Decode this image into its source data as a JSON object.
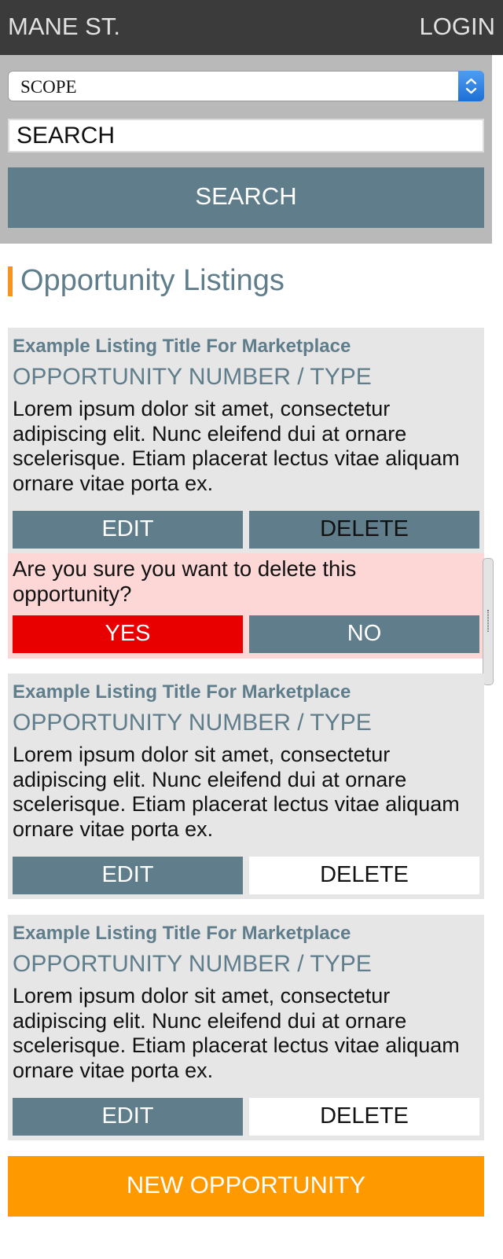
{
  "header": {
    "brand": "MANE ST.",
    "login_label": "LOGIN"
  },
  "search": {
    "scope_label": "SCOPE",
    "input_placeholder": "SEARCH",
    "button_label": "SEARCH"
  },
  "main": {
    "heading": "Opportunity Listings",
    "listings": [
      {
        "title": "Example Listing Title For Marketplace",
        "type": "OPPORTUNITY NUMBER / TYPE",
        "description": "Lorem ipsum dolor sit amet, consectetur adipiscing elit. Nunc eleifend dui at ornare scelerisque. Etiam placerat lectus vitae aliquam ornare vitae porta ex.",
        "edit_label": "EDIT",
        "delete_label": "DELETE"
      },
      {
        "title": "Example Listing Title For Marketplace",
        "type": "OPPORTUNITY NUMBER / TYPE",
        "description": "Lorem ipsum dolor sit amet, consectetur adipiscing elit. Nunc eleifend dui at ornare scelerisque. Etiam placerat lectus vitae aliquam ornare vitae porta ex.",
        "edit_label": "EDIT",
        "delete_label": "DELETE"
      },
      {
        "title": "Example Listing Title For Marketplace",
        "type": "OPPORTUNITY NUMBER / TYPE",
        "description": "Lorem ipsum dolor sit amet, consectetur adipiscing elit. Nunc eleifend dui at ornare scelerisque. Etiam placerat lectus vitae aliquam ornare vitae porta ex.",
        "edit_label": "EDIT",
        "delete_label": "DELETE"
      }
    ],
    "confirm": {
      "question": "Are you sure you want to delete this opportunity?",
      "yes_label": "YES",
      "no_label": "NO"
    },
    "new_button_label": "NEW OPPORTUNITY"
  },
  "colors": {
    "header_bg": "#3b3b3b",
    "panel_bg": "#b9b9b9",
    "primary": "#5f7d8b",
    "accent": "#f7931e",
    "danger": "#e80000",
    "confirm_bg": "#fdd6d6",
    "card_bg": "#e6e6e6",
    "new_button": "#ff9900"
  },
  "icons": {
    "scope_select": "chevron-up-down-icon",
    "scroll": "scroll-handle-icon"
  }
}
